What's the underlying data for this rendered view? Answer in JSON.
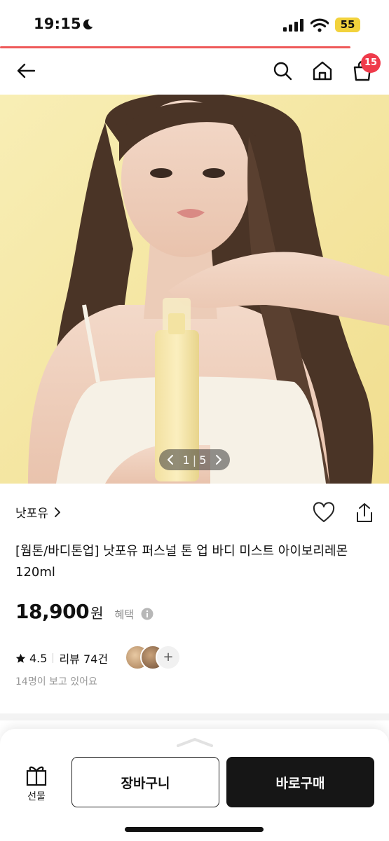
{
  "status_bar": {
    "time": "19:15",
    "battery": "55"
  },
  "nav": {
    "cart_badge": "15",
    "icons": [
      "back-arrow-icon",
      "search-icon",
      "home-icon",
      "shopping-bag-icon"
    ]
  },
  "gallery": {
    "current": "1",
    "total": "5",
    "separator": "|"
  },
  "product": {
    "brand": "낫포유",
    "title": "[웜톤/바디톤업] 낫포유 퍼스널 톤 업 바디 미스트 아이보리레몬 120ml",
    "price": "18,900",
    "price_unit": "원",
    "benefit_label": "혜택",
    "rating": "4.5",
    "review_label": "리뷰 74건",
    "viewers": "14명이 보고 있어요"
  },
  "bottom_bar": {
    "gift_label": "선물",
    "cart_button": "장바구니",
    "buy_button": "바로구매"
  },
  "colors": {
    "accent_red": "#ef3b4b",
    "buy_button_bg": "#161616",
    "battery_yellow": "#f2d23c",
    "hero_background": "#f6eaa6"
  }
}
